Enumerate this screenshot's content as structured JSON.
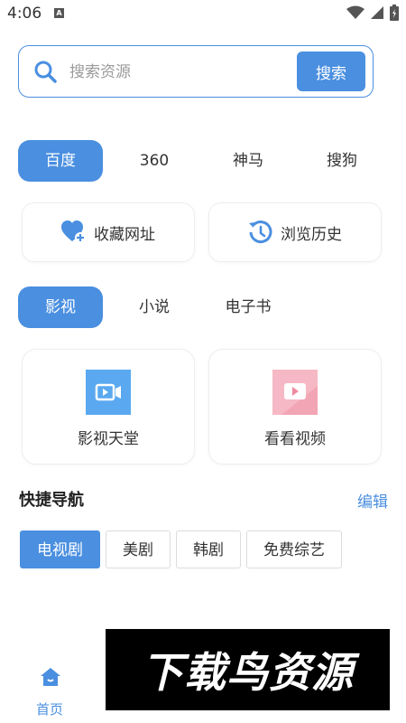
{
  "status_bar": {
    "time": "4:06",
    "badge": "A"
  },
  "search": {
    "placeholder": "搜索资源",
    "value": "",
    "button_label": "搜索"
  },
  "engines": [
    {
      "label": "百度",
      "active": true
    },
    {
      "label": "360",
      "active": false
    },
    {
      "label": "神马",
      "active": false
    },
    {
      "label": "搜狗",
      "active": false
    }
  ],
  "features": {
    "favorites": {
      "label": "收藏网址",
      "icon": "heart-plus-icon"
    },
    "history": {
      "label": "浏览历史",
      "icon": "history-clock-icon"
    }
  },
  "categories_tabs": [
    {
      "label": "影视",
      "active": true
    },
    {
      "label": "小说",
      "active": false
    },
    {
      "label": "电子书",
      "active": false
    }
  ],
  "category_cards": [
    {
      "label": "影视天堂",
      "icon": "video-camera-icon",
      "color": "#5aa9f0"
    },
    {
      "label": "看看视频",
      "icon": "video-play-icon",
      "color": "#f6b8c4"
    }
  ],
  "quick_nav": {
    "title": "快捷导航",
    "edit_label": "编辑",
    "chips": [
      {
        "label": "电视剧",
        "active": true
      },
      {
        "label": "美剧",
        "active": false
      },
      {
        "label": "韩剧",
        "active": false
      },
      {
        "label": "免费综艺",
        "active": false
      }
    ]
  },
  "bottom_nav": {
    "home_label": "首页"
  },
  "watermark": {
    "text": "下载鸟资源"
  },
  "colors": {
    "accent": "#4a8fe0",
    "border": "#eeeeee"
  }
}
